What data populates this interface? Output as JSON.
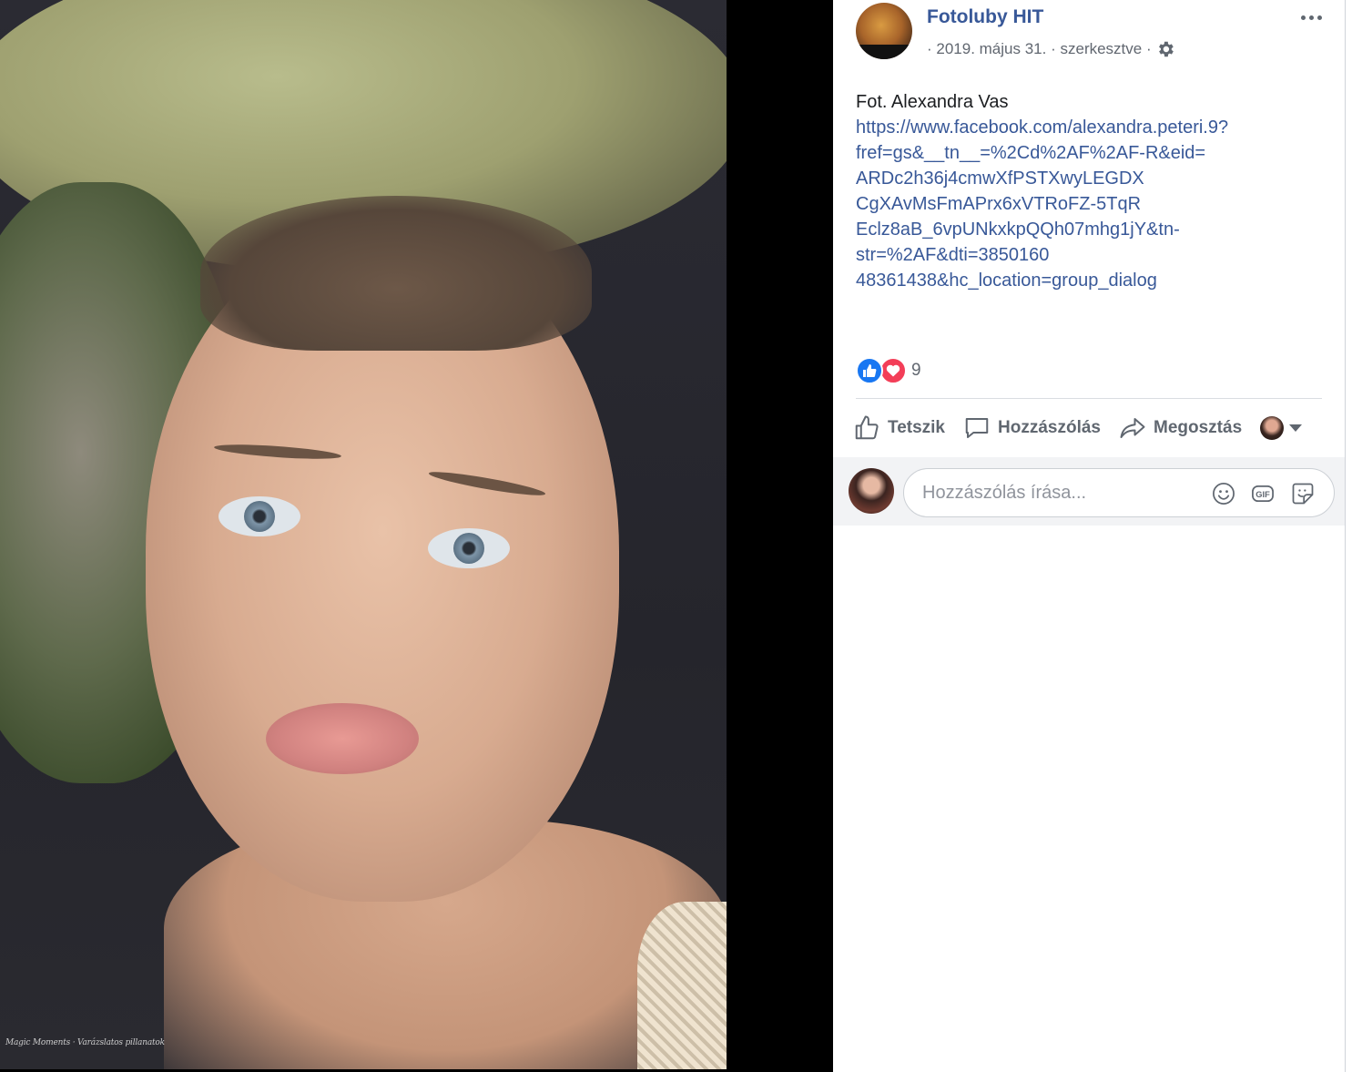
{
  "photo": {
    "alt": "Portrait of a girl with a flower crown",
    "watermark": "Magic Moments · Varázslatos pillanatok"
  },
  "post": {
    "page_name": "Fotoluby HIT",
    "meta": {
      "date": "· 2019. május 31. ·",
      "edited": "szerkesztve ·"
    },
    "text": "Fot. Alexandra Vas",
    "link": "https://www.facebook.com/alexandra.peteri.9?\nfref=gs&__tn__=%2Cd%2AF%2AF-R&eid=\nARDc2h36j4cmwXfPSTXwyLEGDX\nCgXAvMsFmAPrx6xVTRoFZ-5TqR\nEclz8aB_6vpUNkxkpQQh07mhg1jY&tn-\nstr=%2AF&dti=3850160\n48361438&hc_location=group_dialog",
    "reactions": {
      "count": "9",
      "types": [
        "like-icon",
        "love-icon"
      ]
    }
  },
  "actions": {
    "like": "Tetszik",
    "comment": "Hozzászólás",
    "share": "Megosztás"
  },
  "comment_box": {
    "placeholder": "Hozzászólás írása...",
    "gif_label": "GIF"
  },
  "colors": {
    "link": "#385898",
    "like_blue": "#1877f2",
    "love_red": "#f33e58",
    "meta_gray": "#616770",
    "comment_bg": "#f2f3f5"
  }
}
